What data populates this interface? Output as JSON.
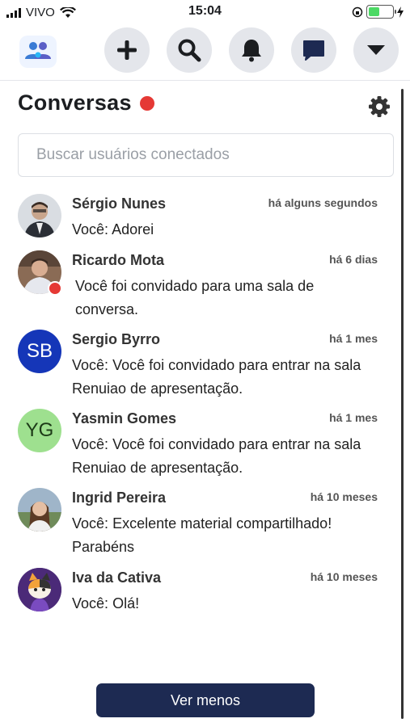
{
  "status_bar": {
    "carrier": "VIVO",
    "time": "15:04",
    "battery_pct": 0.45,
    "icons": [
      "signal-icon",
      "wifi-icon",
      "lock-rotation-icon",
      "battery-icon",
      "charging-icon"
    ]
  },
  "nav": {
    "icons": [
      "app-logo",
      "plus-icon",
      "search-icon",
      "bell-icon",
      "chat-bubble-icon",
      "caret-down-icon"
    ]
  },
  "header": {
    "title": "Conversas",
    "title_dot_color": "#e53935",
    "settings_icon": "gear-icon"
  },
  "search": {
    "placeholder": "Buscar usuários conectados",
    "value": ""
  },
  "conversations": [
    {
      "name": "Sérgio Nunes",
      "time": "há alguns segundos",
      "prefix": "Você:",
      "message": "Adorei",
      "avatar": "photo",
      "online": false
    },
    {
      "name": "Ricardo Mota",
      "time": "há 6 dias",
      "prefix": "",
      "message": "Você foi convidado para uma sala de conversa.",
      "avatar": "photo",
      "online": true
    },
    {
      "name": "Sergio Byrro",
      "time": "há 1 mes",
      "prefix": "Você:",
      "message": "Você foi convidado para entrar na sala Renuiao de apresentação.",
      "avatar_initials": "SB",
      "avatar_color": "#1536b8"
    },
    {
      "name": "Yasmin Gomes",
      "time": "há 1 mes",
      "prefix": "Você:",
      "message": "Você foi convidado para entrar na sala Renuiao de apresentação.",
      "avatar_initials": "YG",
      "avatar_color": "#9ee08f"
    },
    {
      "name": "Ingrid Pereira",
      "time": "há 10 meses",
      "prefix": "Você:",
      "message": "Excelente material compartilhado! Parabéns",
      "avatar": "photo"
    },
    {
      "name": "Iva da Cativa",
      "time": "há 10 meses",
      "prefix": "Você:",
      "message": "Olá!",
      "avatar": "cat-illustration"
    }
  ],
  "footer": {
    "button_label": "Ver menos"
  },
  "colors": {
    "accent": "#1d2a52",
    "red": "#e53935",
    "nav_bg": "#e4e6eb"
  }
}
